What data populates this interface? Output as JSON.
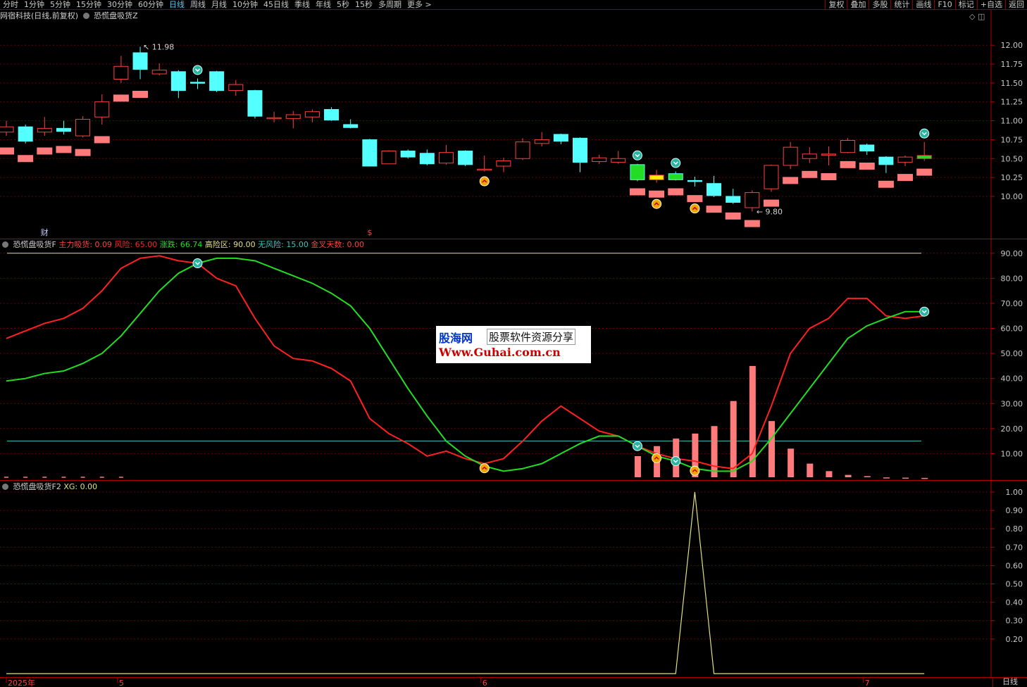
{
  "toolbar": {
    "periods": [
      "分时",
      "1分钟",
      "5分钟",
      "15分钟",
      "30分钟",
      "60分钟",
      "日线",
      "周线",
      "月线",
      "10分钟",
      "45日线",
      "季线",
      "年线",
      "5秒",
      "15秒",
      "多周期",
      "更多 >"
    ],
    "active_period": "日线",
    "actions": [
      "复权",
      "叠加",
      "多股",
      "统计",
      "画线",
      "F10",
      "标记",
      "+自选",
      "返回"
    ]
  },
  "main_panel": {
    "title": "网宿科技(日线,前复权)",
    "indicator_name": "恐慌盘吸货Z",
    "high_label": "11.98",
    "low_label": "9.80",
    "event_labels": [
      "财",
      "$"
    ]
  },
  "panel2": {
    "title": "恐慌盘吸货F",
    "legend": [
      {
        "label": "主力吸货: ",
        "value": "0.09",
        "color": "#ff4040"
      },
      {
        "label": "风险: ",
        "value": "65.00",
        "color": "#ff2020"
      },
      {
        "label": "涨跌: ",
        "value": "66.74",
        "color": "#22dd22"
      },
      {
        "label": "高险区: ",
        "value": "90.00",
        "color": "#e0e080"
      },
      {
        "label": "无风险: ",
        "value": "15.00",
        "color": "#40c0c0"
      },
      {
        "label": "金叉天数: ",
        "value": "0.00",
        "color": "#ff4040"
      }
    ]
  },
  "panel3": {
    "title": "恐慌盘吸货F2",
    "legend": [
      {
        "label": "XG: ",
        "value": "0.00",
        "color": "#e0e080"
      }
    ]
  },
  "x_axis_labels": [
    {
      "label": "2025年",
      "index": 0
    },
    {
      "label": "5",
      "index": 6
    },
    {
      "label": "6",
      "index": 25
    },
    {
      "label": "7",
      "index": 45
    }
  ],
  "bottom_button": "日线",
  "watermark": {
    "logo": "股海网",
    "subtitle": "股票软件资源分享",
    "url": "Www.Guhai.com.cn"
  },
  "colors": {
    "up": "#ff4040",
    "down": "#54ffff",
    "red_line": "#ff2020",
    "green_line": "#22dd22",
    "grid": "#6b0000",
    "high_line": "#e0e080",
    "low_line": "#40c0c0",
    "bars": "#ff7a7a"
  },
  "chart_data": [
    {
      "type": "candlestick",
      "y_ticks": [
        10.0,
        10.25,
        10.5,
        10.75,
        11.0,
        11.25,
        11.5,
        11.75,
        12.0
      ],
      "ylim": [
        9.45,
        12.3
      ],
      "candles": [
        {
          "o": 10.85,
          "c": 10.92,
          "h": 11.0,
          "l": 10.8
        },
        {
          "o": 10.92,
          "c": 10.73,
          "h": 10.95,
          "l": 10.7
        },
        {
          "o": 10.85,
          "c": 10.9,
          "h": 11.05,
          "l": 10.8
        },
        {
          "o": 10.9,
          "c": 10.86,
          "h": 11.0,
          "l": 10.82
        },
        {
          "o": 10.8,
          "c": 11.02,
          "h": 11.06,
          "l": 10.78
        },
        {
          "o": 11.05,
          "c": 11.25,
          "h": 11.35,
          "l": 10.95
        },
        {
          "o": 11.55,
          "c": 11.72,
          "h": 11.86,
          "l": 11.5
        },
        {
          "o": 11.9,
          "c": 11.68,
          "h": 11.98,
          "l": 11.55
        },
        {
          "o": 11.62,
          "c": 11.67,
          "h": 11.76,
          "l": 11.6
        },
        {
          "o": 11.65,
          "c": 11.4,
          "h": 11.67,
          "l": 11.3
        },
        {
          "o": 11.51,
          "c": 11.5,
          "h": 11.56,
          "l": 11.42
        },
        {
          "o": 11.65,
          "c": 11.4,
          "h": 11.66,
          "l": 11.38
        },
        {
          "o": 11.4,
          "c": 11.48,
          "h": 11.54,
          "l": 11.33
        },
        {
          "o": 11.4,
          "c": 11.06,
          "h": 11.41,
          "l": 11.03
        },
        {
          "o": 11.03,
          "c": 11.04,
          "h": 11.12,
          "l": 10.98
        },
        {
          "o": 11.03,
          "c": 11.08,
          "h": 11.13,
          "l": 10.9
        },
        {
          "o": 11.05,
          "c": 11.12,
          "h": 11.15,
          "l": 10.98
        },
        {
          "o": 11.15,
          "c": 11.01,
          "h": 11.18,
          "l": 11.0
        },
        {
          "o": 10.95,
          "c": 10.91,
          "h": 11.02,
          "l": 10.9
        },
        {
          "o": 10.75,
          "c": 10.4,
          "h": 10.76,
          "l": 10.4
        },
        {
          "o": 10.43,
          "c": 10.6,
          "h": 10.61,
          "l": 10.43
        },
        {
          "o": 10.6,
          "c": 10.52,
          "h": 10.62,
          "l": 10.5
        },
        {
          "o": 10.57,
          "c": 10.43,
          "h": 10.62,
          "l": 10.41
        },
        {
          "o": 10.44,
          "c": 10.58,
          "h": 10.68,
          "l": 10.42
        },
        {
          "o": 10.6,
          "c": 10.42,
          "h": 10.61,
          "l": 10.4
        },
        {
          "o": 10.35,
          "c": 10.36,
          "h": 10.54,
          "l": 10.33
        },
        {
          "o": 10.4,
          "c": 10.47,
          "h": 10.51,
          "l": 10.32
        },
        {
          "o": 10.5,
          "c": 10.72,
          "h": 10.77,
          "l": 10.48
        },
        {
          "o": 10.7,
          "c": 10.75,
          "h": 10.85,
          "l": 10.66
        },
        {
          "o": 10.82,
          "c": 10.73,
          "h": 10.83,
          "l": 10.69
        },
        {
          "o": 10.77,
          "c": 10.45,
          "h": 10.78,
          "l": 10.32
        },
        {
          "o": 10.46,
          "c": 10.51,
          "h": 10.55,
          "l": 10.43
        },
        {
          "o": 10.45,
          "c": 10.5,
          "h": 10.6,
          "l": 10.43
        },
        {
          "o": 10.42,
          "c": 10.22,
          "h": 10.43,
          "l": 10.2
        },
        {
          "o": 10.22,
          "c": 10.28,
          "h": 10.35,
          "l": 10.18
        },
        {
          "o": 10.3,
          "c": 10.22,
          "h": 10.33,
          "l": 10.21
        },
        {
          "o": 10.21,
          "c": 10.2,
          "h": 10.26,
          "l": 10.13
        },
        {
          "o": 10.17,
          "c": 10.01,
          "h": 10.27,
          "l": 9.99
        },
        {
          "o": 10.0,
          "c": 9.92,
          "h": 10.1,
          "l": 9.9
        },
        {
          "o": 9.85,
          "c": 10.05,
          "h": 10.08,
          "l": 9.8
        },
        {
          "o": 10.1,
          "c": 10.41,
          "h": 10.42,
          "l": 10.06
        },
        {
          "o": 10.41,
          "c": 10.65,
          "h": 10.72,
          "l": 10.36
        },
        {
          "o": 10.5,
          "c": 10.56,
          "h": 10.65,
          "l": 10.44
        },
        {
          "o": 10.56,
          "c": 10.56,
          "h": 10.66,
          "l": 10.41
        },
        {
          "o": 10.58,
          "c": 10.74,
          "h": 10.77,
          "l": 10.57
        },
        {
          "o": 10.68,
          "c": 10.6,
          "h": 10.7,
          "l": 10.55
        },
        {
          "o": 10.52,
          "c": 10.42,
          "h": 10.53,
          "l": 10.31
        },
        {
          "o": 10.45,
          "c": 10.52,
          "h": 10.54,
          "l": 10.4
        },
        {
          "o": 10.5,
          "c": 10.54,
          "h": 10.72,
          "l": 10.47
        }
      ],
      "special_candles": [
        {
          "index": 33,
          "color": "#22dd22"
        },
        {
          "index": 34,
          "color": "#ffee00"
        },
        {
          "index": 35,
          "color": "#22dd22"
        },
        {
          "index": 48,
          "color": "#22dd22"
        }
      ],
      "salmon_offsets": [
        -0.2,
        -0.2,
        -0.2,
        -0.2,
        -0.2,
        -0.2,
        -0.2,
        -0.2,
        null,
        null,
        null,
        null,
        null,
        null,
        null,
        null,
        null,
        null,
        null,
        null,
        null,
        null,
        null,
        null,
        null,
        null,
        null,
        null,
        null,
        null,
        null,
        null,
        null,
        -0.14,
        -0.15,
        -0.15,
        -0.16,
        -0.16,
        -0.16,
        -0.16,
        -0.15,
        -0.15,
        -0.15,
        -0.15,
        -0.15,
        -0.15,
        -0.15,
        -0.15,
        -0.15
      ],
      "sell_markers": [
        10,
        33,
        35,
        48
      ],
      "buy_markers": [
        25,
        34,
        36
      ]
    },
    {
      "type": "line",
      "y_ticks": [
        10,
        20,
        30,
        40,
        50,
        60,
        70,
        80,
        90
      ],
      "ylim": [
        0,
        95
      ],
      "hlines": [
        90,
        15
      ],
      "series": [
        {
          "name": "风险",
          "color": "#ff2020",
          "values": [
            56,
            59,
            62,
            64,
            68,
            75,
            84,
            88,
            89,
            87,
            86,
            80,
            77,
            64,
            53,
            48,
            47,
            44,
            39,
            24,
            18,
            14,
            9,
            11,
            8,
            6,
            8,
            15,
            23,
            29,
            24,
            19,
            17,
            13,
            10,
            8,
            7,
            5,
            4,
            10,
            29,
            50,
            60,
            64,
            72,
            72,
            65,
            64,
            65
          ]
        },
        {
          "name": "涨跌",
          "color": "#22dd22",
          "values": [
            39,
            40,
            42,
            43,
            46,
            50,
            57,
            66,
            75,
            82,
            86,
            88,
            88,
            87,
            84,
            81,
            78,
            74,
            69,
            60,
            48,
            36,
            25,
            15,
            9,
            5,
            3,
            4,
            6,
            10,
            14,
            17,
            17,
            13,
            9,
            7,
            4,
            3,
            3,
            7,
            16,
            26,
            36,
            46,
            56,
            61,
            64,
            66.7,
            66.7
          ]
        }
      ],
      "bars": {
        "name": "金叉天数",
        "start_index": 33,
        "values": [
          9,
          13,
          16,
          18,
          21,
          31,
          45,
          23,
          12,
          6,
          3,
          1.5,
          1,
          0.5,
          0.4,
          0.3
        ]
      },
      "small_marks_until": 7,
      "sell_markers": [
        10,
        33,
        35,
        48
      ],
      "buy_markers": [
        25,
        34,
        36
      ]
    },
    {
      "type": "line",
      "y_ticks": [
        0.2,
        0.3,
        0.4,
        0.5,
        0.6,
        0.7,
        0.8,
        0.9,
        1.0
      ],
      "ylim": [
        0,
        1.05
      ],
      "series": [
        {
          "name": "XG",
          "color": "#e0e080",
          "spike_index": 36,
          "spike_value": 1.0,
          "spike_start": 35,
          "spike_end": 37
        }
      ]
    }
  ]
}
